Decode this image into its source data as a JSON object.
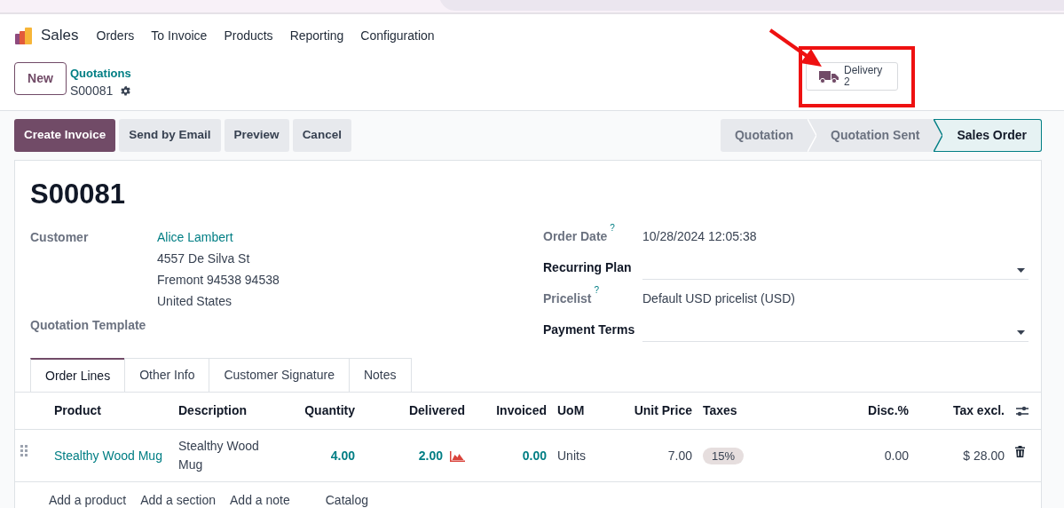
{
  "app": {
    "name": "Sales"
  },
  "menu": [
    "Orders",
    "To Invoice",
    "Products",
    "Reporting",
    "Configuration"
  ],
  "new_button": "New",
  "breadcrumb": {
    "parent": "Quotations",
    "current": "S00081"
  },
  "smart_buttons": [
    {
      "label": "Delivery",
      "count": "2",
      "highlighted": true
    }
  ],
  "actions": [
    {
      "label": "Create Invoice",
      "primary": true
    },
    {
      "label": "Send by Email",
      "primary": false
    },
    {
      "label": "Preview",
      "primary": false
    },
    {
      "label": "Cancel",
      "primary": false
    }
  ],
  "stages": [
    {
      "label": "Quotation",
      "selected": false
    },
    {
      "label": "Quotation Sent",
      "selected": false
    },
    {
      "label": "Sales Order",
      "selected": true
    }
  ],
  "record": {
    "title": "S00081"
  },
  "left_fields": [
    {
      "label": "Customer",
      "kind": "partner",
      "required": false,
      "name": "Alice Lambert",
      "address": [
        "4557 De Silva St",
        "Fremont 94538 94538",
        "United States"
      ]
    },
    {
      "label": "Quotation Template",
      "kind": "empty",
      "required": false
    }
  ],
  "right_fields": [
    {
      "label": "Order Date",
      "kind": "text",
      "required": false,
      "help": "?",
      "value": "10/28/2024 12:05:38"
    },
    {
      "label": "Recurring Plan",
      "kind": "select",
      "required": true
    },
    {
      "label": "Pricelist",
      "kind": "text",
      "required": false,
      "help": "?",
      "value": "Default USD pricelist (USD)"
    },
    {
      "label": "Payment Terms",
      "kind": "select",
      "required": true
    }
  ],
  "tabs": [
    {
      "label": "Order Lines",
      "selected": true
    },
    {
      "label": "Other Info",
      "selected": false
    },
    {
      "label": "Customer Signature",
      "selected": false
    },
    {
      "label": "Notes",
      "selected": false
    }
  ],
  "table": {
    "columns": [
      {
        "label": "Product",
        "kind": "text"
      },
      {
        "label": "Description",
        "kind": "text"
      },
      {
        "label": "Quantity",
        "kind": "number"
      },
      {
        "label": "Delivered",
        "kind": "number"
      },
      {
        "label": "Invoiced",
        "kind": "number"
      },
      {
        "label": "UoM",
        "kind": "text"
      },
      {
        "label": "Unit Price",
        "kind": "number"
      },
      {
        "label": "Taxes",
        "kind": "text"
      },
      {
        "label": "Disc.%",
        "kind": "number"
      },
      {
        "label": "Tax excl.",
        "kind": "number"
      }
    ],
    "rows": [
      {
        "product": "Stealthy Wood Mug",
        "description": "Stealthy Wood Mug",
        "quantity": "4.00",
        "delivered": "2.00",
        "invoiced": "0.00",
        "uom": "Units",
        "unit_price": "7.00",
        "taxes": [
          "15%"
        ],
        "discount": "0.00",
        "subtotal": "$ 28.00"
      }
    ]
  },
  "footer_links": [
    "Add a product",
    "Add a section",
    "Add a note",
    "Catalog"
  ]
}
